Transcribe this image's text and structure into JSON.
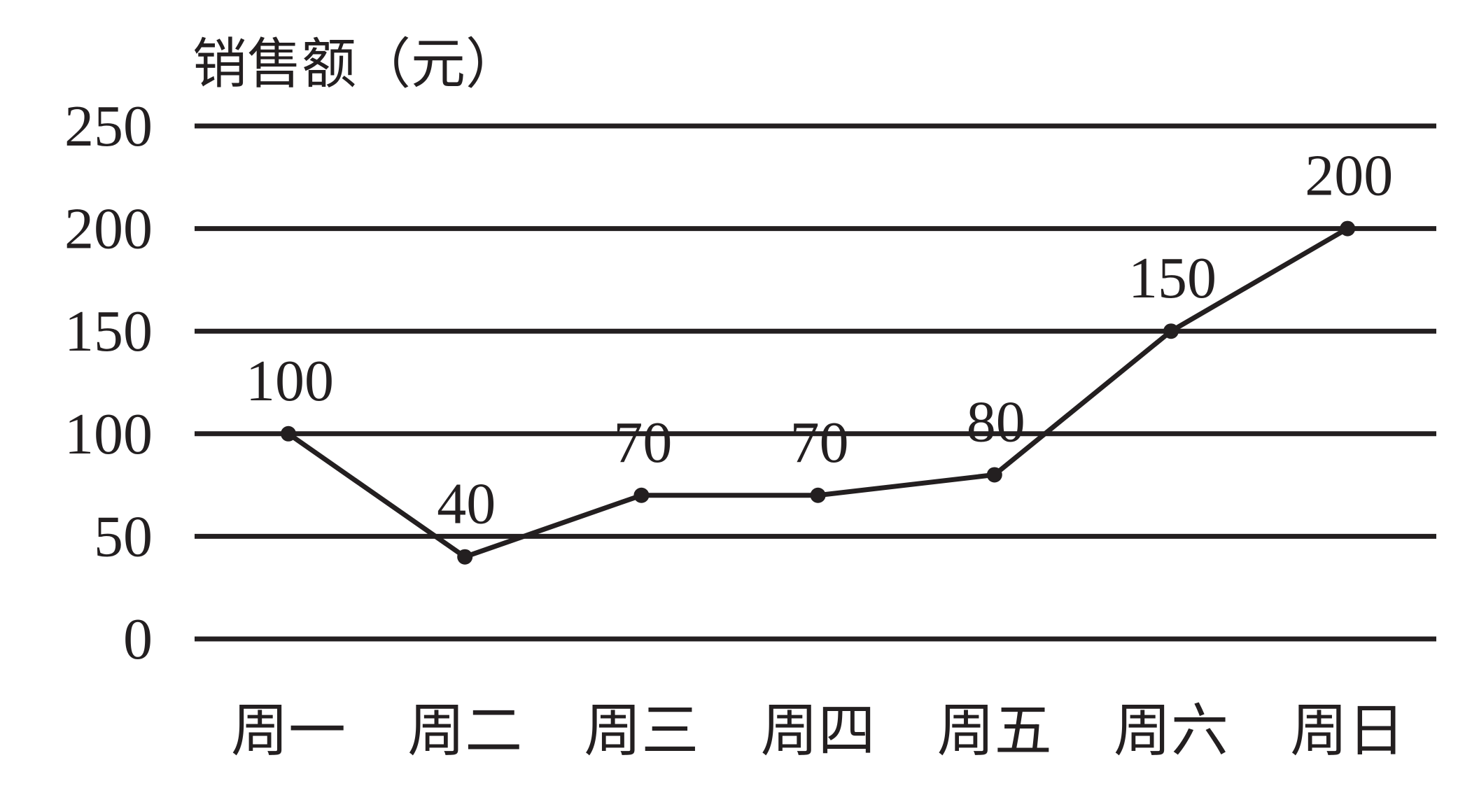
{
  "chart_data": {
    "type": "line",
    "title": "",
    "xlabel": "",
    "ylabel": "销售额（元）",
    "ylim": [
      0,
      250
    ],
    "yticks": [
      0,
      50,
      100,
      150,
      200,
      250
    ],
    "grid": true,
    "legend": "none",
    "categories": [
      "周一",
      "周二",
      "周三",
      "周四",
      "周五",
      "周六",
      "周日"
    ],
    "series": [
      {
        "values": [
          100,
          40,
          70,
          70,
          80,
          150,
          200
        ],
        "labels": [
          "100",
          "40",
          "70",
          "70",
          "80",
          "150",
          "200"
        ],
        "color": "#231f20"
      }
    ]
  }
}
